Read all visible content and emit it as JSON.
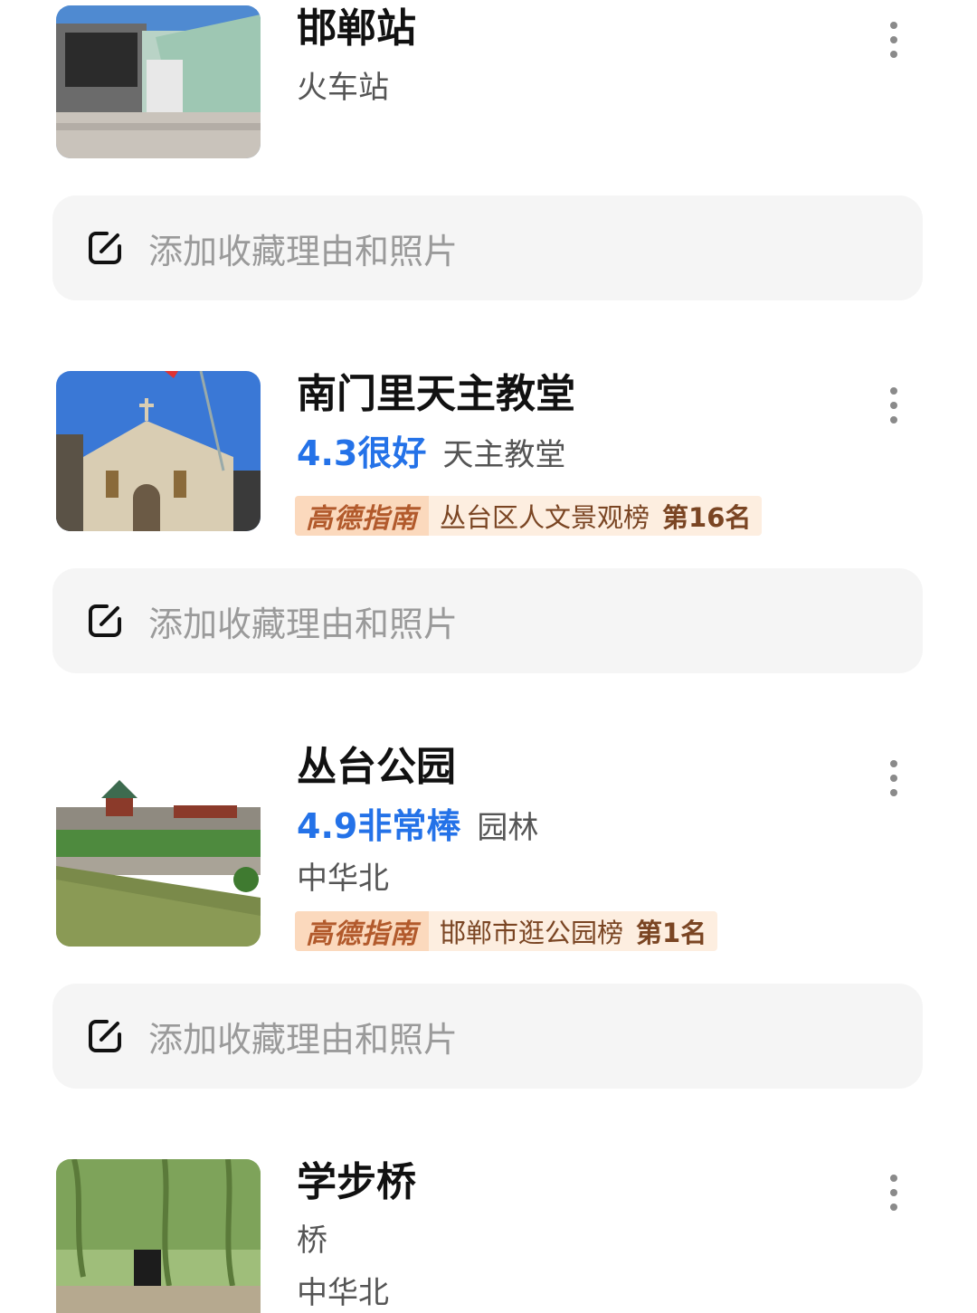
{
  "items": [
    {
      "name": "邯郸站",
      "category": "火车站",
      "note_placeholder": "添加收藏理由和照片"
    },
    {
      "name": "南门里天主教堂",
      "rating": "4.3很好",
      "category": "天主教堂",
      "badge": {
        "brand": "高德指南",
        "list": "丛台区人文景观榜",
        "rank": "第16名"
      },
      "note_placeholder": "添加收藏理由和照片"
    },
    {
      "name": "丛台公园",
      "rating": "4.9非常棒",
      "category": "园林",
      "area": "中华北",
      "badge": {
        "brand": "高德指南",
        "list": "邯郸市逛公园榜",
        "rank": "第1名"
      },
      "note_placeholder": "添加收藏理由和照片"
    },
    {
      "name": "学步桥",
      "category": "桥",
      "area": "中华北"
    }
  ],
  "icons": {
    "more": "more-vertical-icon",
    "edit": "edit-icon"
  },
  "colors": {
    "rating": "#2472e8",
    "badge_bg": "#fdeee0",
    "badge_brand_bg": "#fbd9bd",
    "note_bg": "#f5f5f5"
  }
}
